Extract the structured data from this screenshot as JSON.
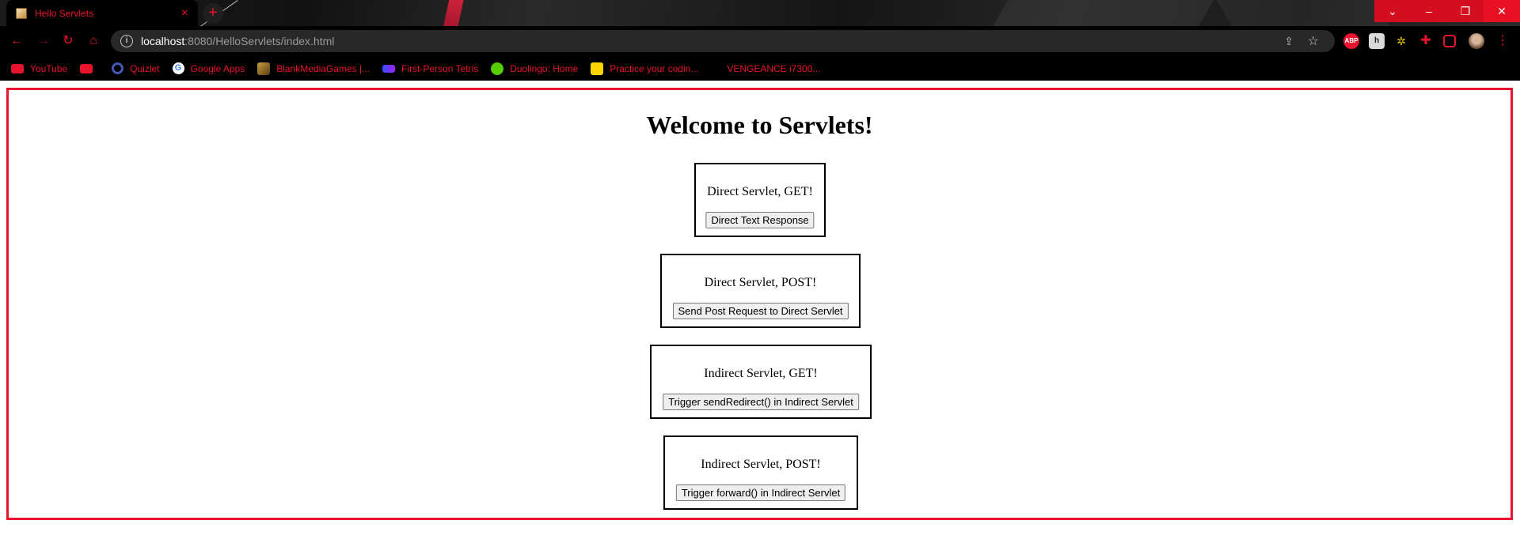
{
  "browser": {
    "tab_title": "Hello Servlets",
    "tab_close": "×",
    "new_tab": "+",
    "window_controls": [
      "⌄",
      "–",
      "❐",
      "✕"
    ],
    "nav": {
      "back": "←",
      "forward": "→",
      "reload": "↻",
      "home": "⌂"
    },
    "url_host": "localhost",
    "url_rest": ":8080/HelloServlets/index.html",
    "bookmarks": [
      {
        "label": "YouTube",
        "icon": "youtube-icon"
      },
      {
        "label": "",
        "icon": "youtube-icon"
      },
      {
        "label": "Quizlet",
        "icon": "quizlet-icon"
      },
      {
        "label": "Google Apps",
        "icon": "google-icon"
      },
      {
        "label": "BlankMediaGames |...",
        "icon": "blankmediagames-icon"
      },
      {
        "label": "First-Person Tetris",
        "icon": "tetris-icon"
      },
      {
        "label": "Duolingo: Home",
        "icon": "duolingo-icon"
      },
      {
        "label": "Practice your codin...",
        "icon": "code-icon"
      },
      {
        "label": "VENGEANCE i7300...",
        "icon": ""
      }
    ],
    "accent_color": "#e8132c"
  },
  "page": {
    "title": "Welcome to Servlets!",
    "panels": [
      {
        "label": "Direct Servlet, GET!",
        "button": "Direct Text Response"
      },
      {
        "label": "Direct Servlet, POST!",
        "button": "Send Post Request to Direct Servlet"
      },
      {
        "label": "Indirect Servlet, GET!",
        "button": "Trigger sendRedirect() in Indirect Servlet"
      },
      {
        "label": "Indirect Servlet, POST!",
        "button": "Trigger forward() in Indirect Servlet"
      }
    ]
  }
}
